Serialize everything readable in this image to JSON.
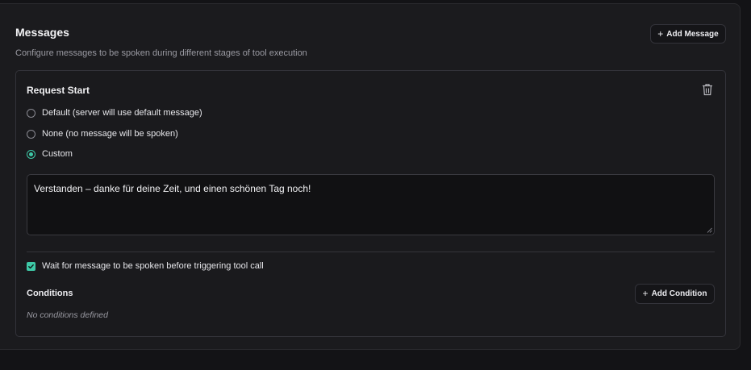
{
  "messages_panel": {
    "title": "Messages",
    "subtitle": "Configure messages to be spoken during different stages of tool execution",
    "add_message_label": "Add Message",
    "add_icon": "plus-icon"
  },
  "card": {
    "title": "Request Start",
    "delete_icon": "trash-icon",
    "options": [
      {
        "label": "Default (server will use default message)",
        "checked": false
      },
      {
        "label": "None (no message will be spoken)",
        "checked": false
      },
      {
        "label": "Custom",
        "checked": true
      }
    ],
    "custom_message": "Verstanden – danke für deine Zeit, und einen schönen Tag noch!",
    "wait_checkbox_label": "Wait for message to be spoken before triggering tool call",
    "wait_checked": true,
    "conditions_title": "Conditions",
    "add_condition_label": "Add Condition",
    "no_conditions_text": "No conditions defined"
  },
  "colors": {
    "accent": "#3ec9a7",
    "background": "#131316",
    "panel": "#1b1b1e"
  }
}
